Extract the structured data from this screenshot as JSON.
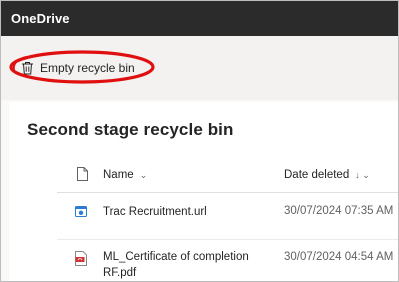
{
  "app": {
    "title": "OneDrive"
  },
  "toolbar": {
    "empty_recycle_bin_label": "Empty recycle bin"
  },
  "page": {
    "title": "Second stage recycle bin"
  },
  "table": {
    "columns": [
      {
        "label": "Name",
        "sort_glyph": "⌄"
      },
      {
        "label": "Date deleted",
        "sort_glyph": "↓ ⌄"
      }
    ],
    "rows": [
      {
        "name": "Trac Recruitment.url",
        "date_deleted": "30/07/2024 07:35 AM",
        "icon": "url-file-icon"
      },
      {
        "name": "ML_Certificate of completion RF.pdf",
        "name_line1": "ML_Certificate of completion",
        "name_line2": "RF.pdf",
        "date_deleted": "30/07/2024 04:54 AM",
        "icon": "pdf-file-icon"
      }
    ]
  },
  "colors": {
    "topbar": "#2b2b2b",
    "highlight_ring": "#e01010",
    "url_icon": "#2b7cd3",
    "pdf_icon": "#d13438"
  }
}
